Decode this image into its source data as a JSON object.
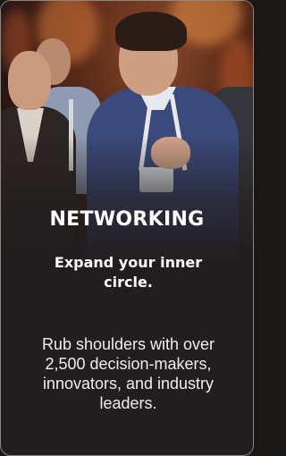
{
  "card": {
    "title": "NETWORKING",
    "subtitle": "Expand your inner circle.",
    "description": "Rub shoulders with over 2,500 decision-makers, innovators, and industry leaders."
  },
  "colors": {
    "card_background": "#221d1e",
    "border": "#8d8780",
    "text": "#ffffff"
  }
}
